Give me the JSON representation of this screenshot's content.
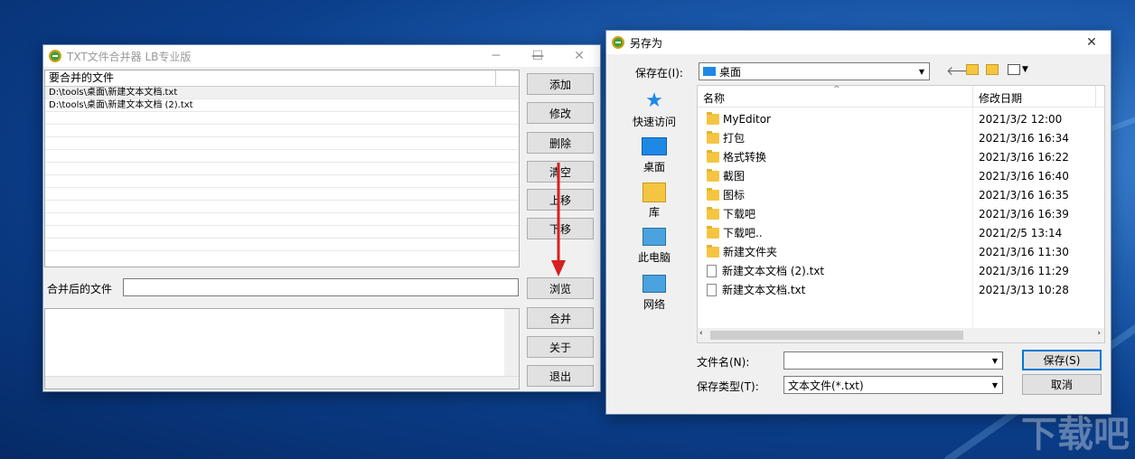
{
  "left_window": {
    "title": "TXT文件合并器 LB专业版",
    "column_header": "要合并的文件",
    "files": [
      "D:\\tools\\桌面\\新建文本文档.txt",
      "D:\\tools\\桌面\\新建文本文档 (2).txt"
    ],
    "buttons": {
      "add": "添加",
      "edit": "修改",
      "delete": "删除",
      "clear": "清空",
      "up": "上移",
      "down": "下移",
      "browse": "浏览",
      "merge": "合并",
      "about": "关于",
      "exit": "退出"
    },
    "merged_label": "合并后的文件",
    "merged_value": ""
  },
  "dialog": {
    "title": "另存为",
    "save_in_label": "保存在(I):",
    "save_in_value": "桌面",
    "places": [
      "快速访问",
      "桌面",
      "库",
      "此电脑",
      "网络"
    ],
    "col_name": "名称",
    "col_date": "修改日期",
    "items": [
      {
        "name": "MyEditor",
        "date": "2021/3/2 12:00",
        "type": "folder"
      },
      {
        "name": "打包",
        "date": "2021/3/16 16:34",
        "type": "folder"
      },
      {
        "name": "格式转换",
        "date": "2021/3/16 16:22",
        "type": "folder"
      },
      {
        "name": "截图",
        "date": "2021/3/16 16:40",
        "type": "folder"
      },
      {
        "name": "图标",
        "date": "2021/3/16 16:35",
        "type": "folder"
      },
      {
        "name": "下载吧",
        "date": "2021/3/16 16:39",
        "type": "folder"
      },
      {
        "name": "下载吧..",
        "date": "2021/2/5 13:14",
        "type": "folder"
      },
      {
        "name": "新建文件夹",
        "date": "2021/3/16 11:30",
        "type": "folder"
      },
      {
        "name": "新建文本文档 (2).txt",
        "date": "2021/3/16 11:29",
        "type": "file"
      },
      {
        "name": "新建文本文档.txt",
        "date": "2021/3/13 10:28",
        "type": "file"
      }
    ],
    "filename_label": "文件名(N):",
    "filename_value": "",
    "filetype_label": "保存类型(T):",
    "filetype_value": "文本文件(*.txt)",
    "save_button": "保存(S)",
    "cancel_button": "取消"
  },
  "watermark": "下载吧"
}
